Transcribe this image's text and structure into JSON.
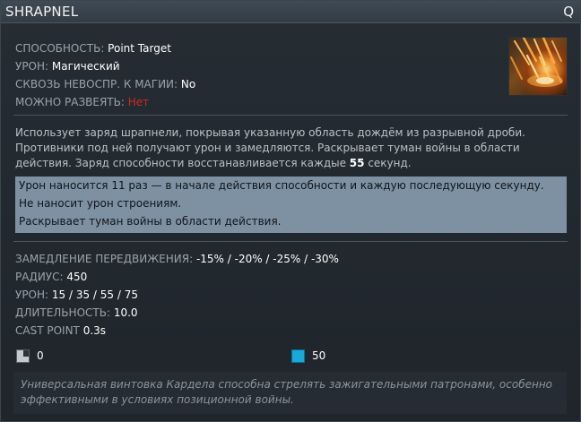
{
  "header": {
    "title": "SHRAPNEL",
    "hotkey": "Q"
  },
  "thumbnail": {
    "icon": "shrapnel-ability-icon"
  },
  "stats": [
    {
      "label": "СПОСОБНОСТЬ: ",
      "value": "Point Target",
      "color": "#ffffff"
    },
    {
      "label": "УРОН: ",
      "value": "Магический",
      "color": "#ffffff"
    },
    {
      "label": "СКВОЗЬ НЕВОСПР. К МАГИИ: ",
      "value": "No",
      "color": "#ffffff"
    },
    {
      "label": "МОЖНО РАЗВЕЯТЬ: ",
      "value": "Нет",
      "color": "#cc2a22"
    }
  ],
  "description": {
    "text": "Использует заряд шрапнели, покрывая указанную область дождём из разрывной дроби. Противники под ней получают урон и замедляются. Раскрывает туман войны в области действия. Заряд способности восстанавливается каждые ",
    "highlight": "55",
    "suffix": " секунд."
  },
  "notes": [
    "Урон наносится 11 раз — в начале действия способности и каждую последующую секунду.",
    "Не наносит урон строениям.",
    "Раскрывает туман войны в области действия."
  ],
  "values": [
    {
      "label": "ЗАМЕДЛЕНИЕ ПЕРЕДВИЖЕНИЯ: ",
      "value": "-15% / -20% / -25% / -30%"
    },
    {
      "label": "РАДИУС: ",
      "value": "450"
    },
    {
      "label": "УРОН: ",
      "value": "15 / 35 / 55 / 75"
    },
    {
      "label": "ДЛИТЕЛЬНОСТЬ: ",
      "value": "10.0"
    },
    {
      "label": "CAST POINT ",
      "value": "0.3s"
    }
  ],
  "costs": {
    "cooldown": {
      "icon": "cooldown-icon",
      "value": "0"
    },
    "mana": {
      "icon": "mana-icon",
      "value": "50",
      "color": "#1aa7d9"
    }
  },
  "lore": "Универсальная винтовка Кардела способна стрелять зажигательными патронами, особенно эффективными в условиях позиционной войны."
}
